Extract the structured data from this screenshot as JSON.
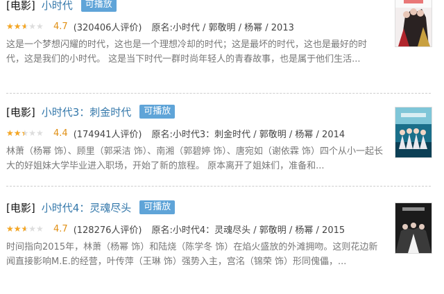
{
  "results": [
    {
      "category": "[电影]",
      "title": "小时代",
      "play_label": "可播放",
      "stars": 0.47,
      "score": "4.7",
      "count": "(320406人评价)",
      "meta": "原名:小时代 / 郭敬明 / 杨幂 / 2013",
      "desc": "这是一个梦想闪耀的时代，这也是一个理想冷却的时代；这是最坏的时代，这也是最好的时代，这是我们的小时代。 这是当下时代一群时尚年轻人的青春故事，也是属于他们生活..."
    },
    {
      "category": "[电影]",
      "title": "小时代3：刺金时代",
      "play_label": "可播放",
      "stars": 0.44,
      "score": "4.4",
      "count": "(174941人评价)",
      "meta": "原名:小时代3：刺金时代 / 郭敬明 / 杨幂 / 2014",
      "desc": "林萧（杨幂 饰）、顾里（郭采洁 饰）、南湘（郭碧婷 饰）、唐宛如（谢依霖 饰）四个从小一起长大的好姐妹大学毕业进入职场，开始了新的旅程。 原本离开了姐妹们，准备和..."
    },
    {
      "category": "[电影]",
      "title": "小时代4：灵魂尽头",
      "play_label": "可播放",
      "stars": 0.47,
      "score": "4.7",
      "count": "(128276人评价)",
      "meta": "原名:小时代4：灵魂尽头 / 郭敬明 / 杨幂 / 2015",
      "desc": "时间指向2015年，林萧（杨幂 饰）和陆烧（陈学冬 饰）在焰火盛放的外滩拥吻。这则花边新闻直接影响M.E.的经营，叶传萍（王琳 饰）强势入主，宫洺（锦荣 饰）形同傀儡，..."
    }
  ],
  "colors": {
    "title_link": "#3377aa",
    "play_badge": "#5fa4d8",
    "score": "#e09015",
    "star": "#f5a623"
  }
}
